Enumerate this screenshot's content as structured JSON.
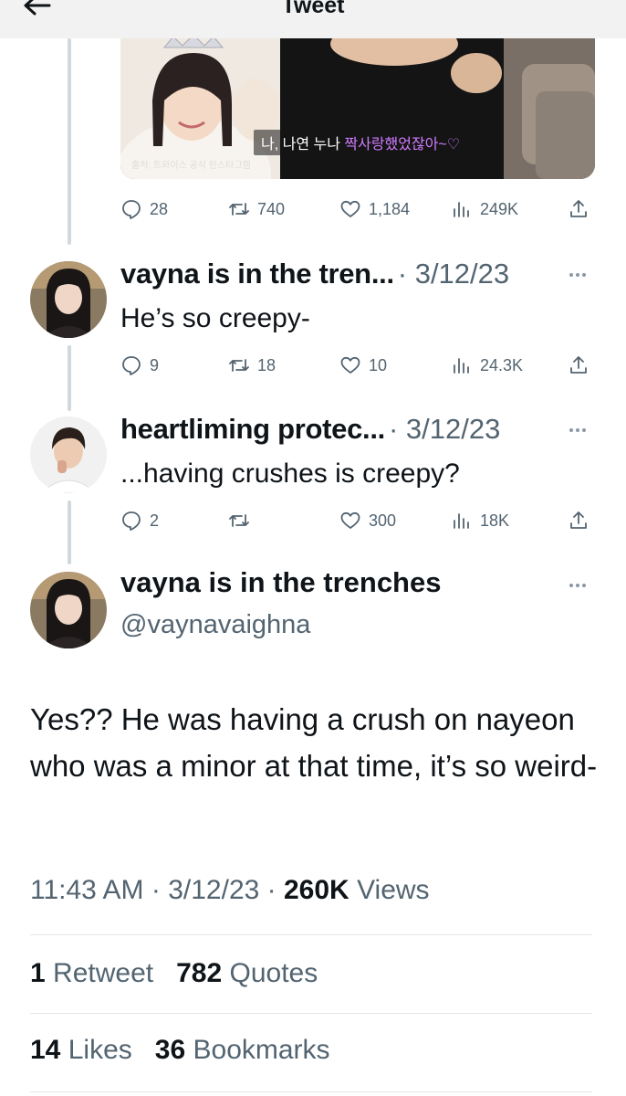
{
  "header": {
    "title": "Tweet",
    "back_icon": "arrow-left-icon"
  },
  "media": {
    "caption_prefix": "나, 나연 누나 ",
    "caption_highlight": "짝사랑했었잖아~♡",
    "source": "출처: 트와이스 공식 인스타그램"
  },
  "parent_tweet": {
    "replies": "28",
    "retweets": "740",
    "likes": "1,184",
    "views": "249K"
  },
  "reply1": {
    "name": "vayna is in the tren...",
    "date": "· 3/12/23",
    "text": "He’s so creepy-",
    "replies": "9",
    "retweets": "18",
    "likes": "10",
    "views": "24.3K"
  },
  "reply2": {
    "name": "heartliming protec...",
    "date": "· 3/12/23",
    "text": "...having crushes is creepy?",
    "replies": "2",
    "retweets": "",
    "likes": "300",
    "views": "18K"
  },
  "main_tweet": {
    "name": "vayna is in the trenches",
    "handle": "@vaynavaighna",
    "text": "Yes?? He was having a crush on nayeon who was a minor at that time, it’s so weird-",
    "time": "11:43 AM",
    "date": "3/12/23",
    "views_count": "260K",
    "views_label": "Views",
    "retweets_count": "1",
    "retweets_label": "Retweet",
    "quotes_count": "782",
    "quotes_label": "Quotes",
    "likes_count": "14",
    "likes_label": "Likes",
    "bookmarks_count": "36",
    "bookmarks_label": "Bookmarks"
  },
  "colors": {
    "text": "#0f1419",
    "secondary": "#536471",
    "thread_line": "#cfd9de",
    "caption_highlight": "#d07bff"
  }
}
